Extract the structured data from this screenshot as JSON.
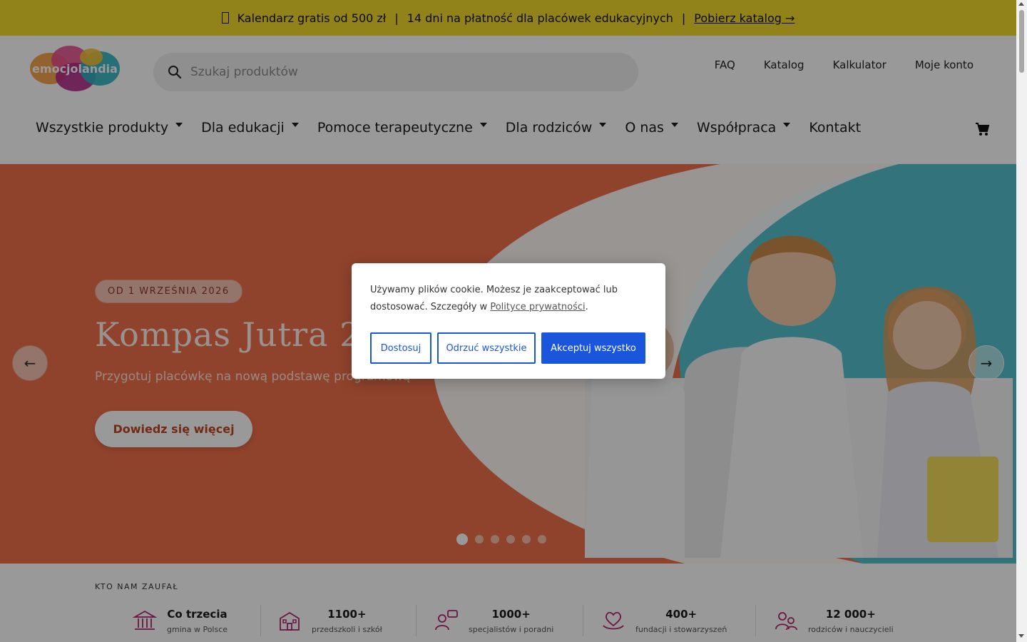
{
  "promo": {
    "icon": "calendar-icon",
    "item1": "Kalendarz gratis od 500 zł",
    "sep": "|",
    "item2": "14 dni na płatność dla placówek edukacyjnych",
    "link": "Pobierz katalog →"
  },
  "header": {
    "logo_text": "emocjolandia",
    "search_placeholder": "Szukaj produktów",
    "top_links": [
      "FAQ",
      "Katalog",
      "Kalkulator",
      "Moje konto"
    ],
    "nav": [
      "Wszystkie produkty",
      "Dla edukacji",
      "Pomoce terapeutyczne",
      "Dla rodziców",
      "O nas",
      "Współpraca",
      "Kontakt"
    ]
  },
  "hero": {
    "badge": "OD 1 WRZEŚNIA 2026",
    "title": "Kompas Jutra 20",
    "subtitle": "Przygotuj placówkę na nową podstawę programową",
    "button": "Dowiedz się więcej",
    "slides_total": 6,
    "active_slide": 1
  },
  "trust": {
    "title": "KTO NAM ZAUFAŁ",
    "stats": [
      {
        "num": "Co trzecia",
        "label": "gmina w Polsce",
        "icon": "government-building-icon"
      },
      {
        "num": "1100+",
        "label": "przedszkoli i szkół",
        "icon": "school-icon"
      },
      {
        "num": "1000+",
        "label": "specjalistów i poradni",
        "icon": "specialist-chat-icon"
      },
      {
        "num": "400+",
        "label": "fundacji i stowarzyszeń",
        "icon": "heart-hand-icon"
      },
      {
        "num": "12 000+",
        "label": "rodziców i nauczycieli",
        "icon": "people-icon"
      }
    ]
  },
  "cookie": {
    "text": "Używamy plików cookie. Możesz je zaakceptować lub dostosować. Szczegóły w ",
    "link": "Polityce prywatności",
    "end": ".",
    "btn_customize": "Dostosuj",
    "btn_reject": "Odrzuć wszystkie",
    "btn_accept": "Akceptuj wszystko"
  },
  "colors": {
    "promo_bg": "#f2d92a",
    "hero_orange": "#f0704a",
    "hero_teal": "#56c2cf",
    "accept_blue": "#1a56db"
  }
}
